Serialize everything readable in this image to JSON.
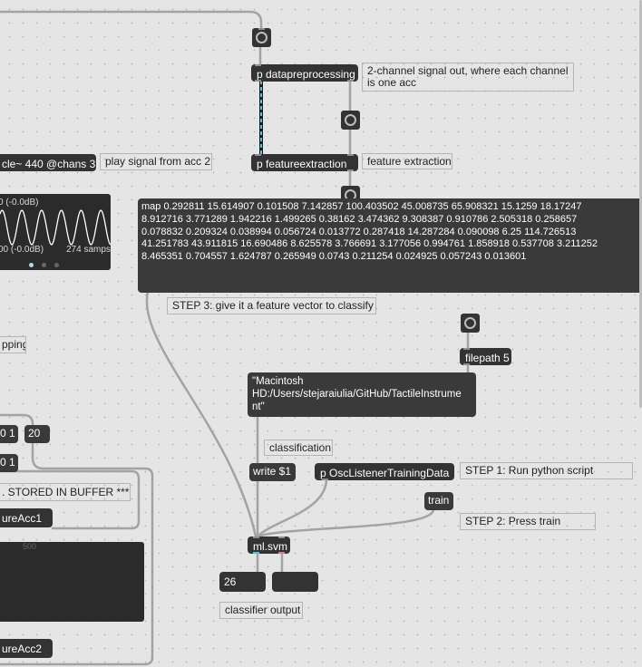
{
  "objects": {
    "datapreprocessing": "p datapreprocessing",
    "featureextraction": "p featureextraction",
    "cycle": "cle~ 440 @chans 3",
    "filepath": "filepath 5",
    "write": "write $1",
    "osc_listener": "p OscListenerTrainingData",
    "train": "train",
    "svm": "ml.svm",
    "buffer_acc1": "ureAcc1",
    "buffer_acc2": "ureAcc2",
    "msg_20": "20",
    "msg_01_a": "0 1",
    "msg_01_b": "0 1"
  },
  "comments": {
    "two_channel": "2-channel signal out, where each channel\nis one acc",
    "feature_extraction": "feature extraction",
    "play_signal": "play signal from acc 2",
    "step3": "STEP 3: give it a feature vector to classify",
    "classification": "classification",
    "step1": "STEP 1: Run python script",
    "step2": "STEP 2: Press train",
    "classifier_output": "classifier output",
    "pping": "pping",
    "stored_in_buffer": ". STORED IN BUFFER ***"
  },
  "messages": {
    "feature_vector": "map 0.292811 15.614907 0.101508 7.142857 100.403502 45.008735 65.908321 15.1259 18.17247\n8.912716 3.771289 1.942216 1.499265 0.38162 3.474362 9.308387 0.910786 2.505318 0.258657\n0.078832 0.209324 0.038994 0.056724 0.013772 0.287418 14.287284 0.090098 6.25 114.726513\n41.251783 43.911815 16.690486 8.625578 3.766691 3.177056 0.994761 1.858918 0.537708 3.211252\n8.465351 0.704557 1.624787 0.265949 0.0743 0.211254 0.024925 0.057243 0.013601",
    "filepath_value": "\"Macintosh\nHD:/Users/stejaraiulia/GitHub/TactileInstrume\nnt\""
  },
  "scope": {
    "label_top": "0 (-0.0dB)",
    "label_bottom": "00 (-0.0dB)",
    "samples": "274 samps",
    "accent_color": "#ffffff"
  },
  "buffer": {
    "tick": "500"
  },
  "number_boxes": {
    "classifier_value": "26",
    "second_value": ""
  },
  "colors": {
    "signal_cord": "#4cc6dc",
    "canvas": "#e5e5e5",
    "object": "#333333"
  }
}
